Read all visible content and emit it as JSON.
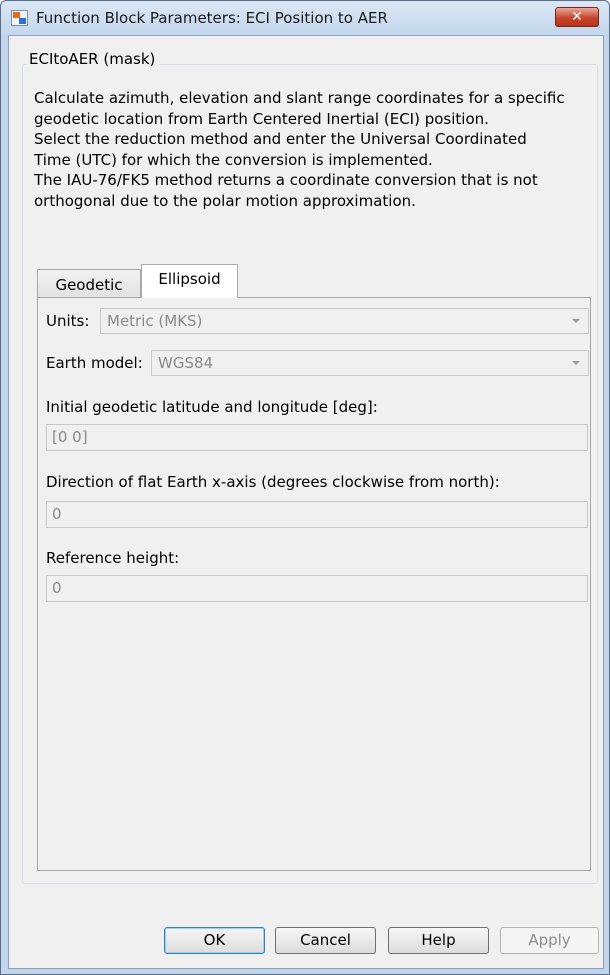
{
  "window": {
    "title": "Function Block Parameters: ECI Position to AER",
    "close_glyph": "✕"
  },
  "mask": {
    "group_title": "ECItoAER (mask)",
    "description_lines": [
      "Calculate azimuth, elevation and slant range coordinates for a specific",
      "geodetic location from Earth Centered Inertial (ECI) position.",
      "Select the reduction method and enter the Universal Coordinated",
      "Time (UTC) for which the conversion is implemented.",
      "The IAU-76/FK5 method returns a coordinate conversion that is not",
      "orthogonal due to the polar motion approximation."
    ]
  },
  "tabs": [
    {
      "label": "Geodetic",
      "active": false
    },
    {
      "label": "Ellipsoid",
      "active": true
    }
  ],
  "params": {
    "units_label": "Units:",
    "units_value": "Metric (MKS)",
    "earth_model_label": "Earth model:",
    "earth_model_value": "WGS84",
    "latlon_label": "Initial geodetic latitude and longitude [deg]:",
    "latlon_value": "[0 0]",
    "direction_label": "Direction of flat Earth x-axis (degrees clockwise from north):",
    "direction_value": "0",
    "refheight_label": "Reference height:",
    "refheight_value": "0"
  },
  "buttons": {
    "ok": "OK",
    "cancel": "Cancel",
    "help": "Help",
    "apply": "Apply"
  },
  "icons": {
    "app_icon": "simulink-block-icon",
    "close_icon": "close-icon",
    "dropdown_icon": "chevron-down-icon"
  },
  "colors": {
    "titlebar": "#c4d6ec",
    "close_button": "#c7462f",
    "dialog_bg": "#f0f0f0",
    "disabled_text": "#8a8a8a"
  }
}
